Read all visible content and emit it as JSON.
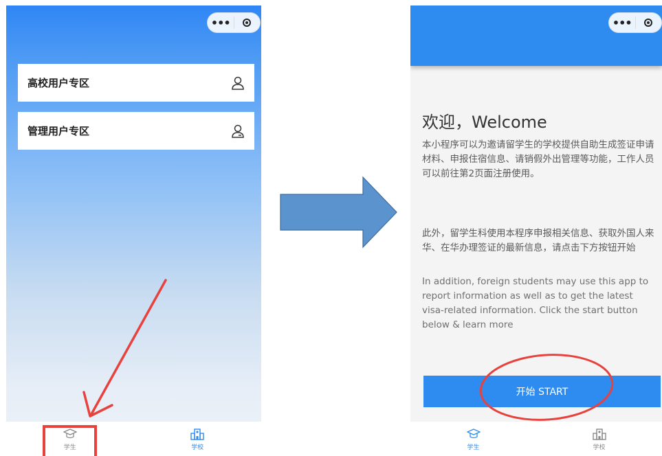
{
  "left_screen": {
    "cards": [
      {
        "label": "高校用户专区",
        "icon": "person-icon"
      },
      {
        "label": "管理用户专区",
        "icon": "person-badge-icon"
      }
    ],
    "tabs": [
      {
        "label": "学生",
        "icon": "graduation-cap-icon"
      },
      {
        "label": "学校",
        "icon": "school-building-icon"
      }
    ]
  },
  "right_screen": {
    "title": "欢迎，Welcome",
    "intro": "本小程序可以为邀请留学生的学校提供自助生成签证申请材料、申报住宿信息、请销假外出管理等功能，工作人员可以前往第2页面注册使用。",
    "chinese_note": "此外，留学生科使用本程序申报相关信息、获取外国人来华、在华办理签证的最新信息，请点击下方按钮开始",
    "english_note": "In addition, foreign students may use this app to report information as well as to get the latest visa-related information. Click the start button below & learn more",
    "start_button": "开始 START",
    "tabs": [
      {
        "label": "学生",
        "icon": "graduation-cap-icon"
      },
      {
        "label": "学校",
        "icon": "school-building-icon"
      }
    ]
  },
  "colors": {
    "primary": "#2e8cf0",
    "annotation": "#e8423e",
    "arrow_fill": "#5b93cf"
  }
}
